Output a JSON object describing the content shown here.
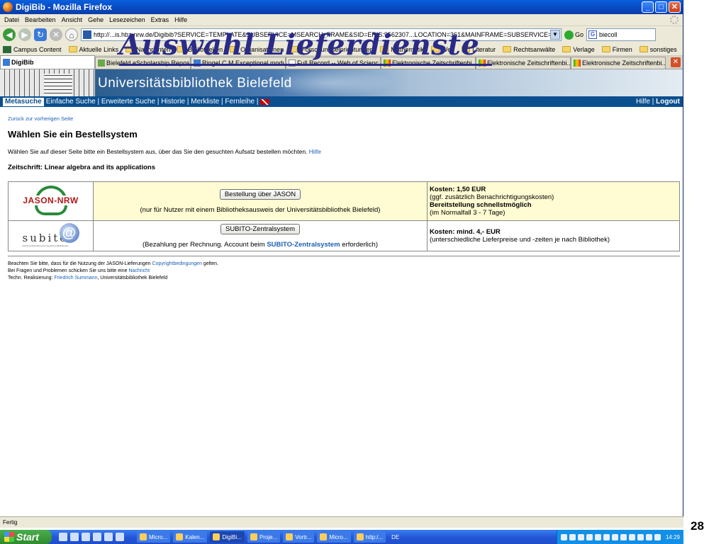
{
  "window": {
    "title": "DigiBib - Mozilla Firefox",
    "minimize": "_",
    "maximize": "□",
    "close": "✕"
  },
  "menu": [
    "Datei",
    "Bearbeiten",
    "Ansicht",
    "Gehe",
    "Lesezeichen",
    "Extras",
    "Hilfe"
  ],
  "navbar": {
    "url": "http://...is.hbz-nrw.de/Digibib?SERVICE=TEMPLATE&SUBSERVICE=MSEARCH_FRAME&SID=ERIS:9562307...LOCATION=361&MAINFRAME=SUBSERVICE=MSEARCH_SEARCH",
    "go_label": "Go",
    "search_value": "biecoll",
    "search_engine_icon": "G"
  },
  "bookmarks": [
    "Campus Content",
    "Aktuelle Links",
    "Nachrichten",
    "Bibliotheken",
    "Organisationen",
    "Forschungseinrichtungen",
    "Mathematik",
    "Web",
    "Literatur",
    "Rechtsanwälte",
    "Verlage",
    "Firmen",
    "sonstiges"
  ],
  "tabs": [
    {
      "label": "DigiBib",
      "active": true
    },
    {
      "label": "Bielefeld eScholarship Reposi...",
      "active": false
    },
    {
      "label": "Ringel C M Exceptional modul...",
      "active": false
    },
    {
      "label": "Full Record -- Web of Scienc...",
      "active": false
    },
    {
      "label": "Elektronische Zeitschriftenbi...",
      "active": false
    },
    {
      "label": "Elektronische Zeitschriftenbi...",
      "active": false
    },
    {
      "label": "Elektronische Zeitschriftenbi...",
      "active": false
    }
  ],
  "tab_close": "✕",
  "banner": {
    "title": "Universitätsbibliothek Bielefeld"
  },
  "bluenav": {
    "active": "Metasuche",
    "links": "Einfache Suche | Erweiterte Suche | Historie | Merkliste | Fernleihe |",
    "help": "Hilfe",
    "separator": "|",
    "logout": "Logout"
  },
  "content": {
    "back_link": "Zurück zur vorherigen Seite",
    "heading": "Wählen Sie ein Bestellsystem",
    "intro": "Wählen Sie auf dieser Seite bitte ein Bestellsystem aus, über das Sie den gesuchten Aufsatz bestellen möchten.",
    "intro_help": "Hilfe",
    "journal": "Zeitschrift: Linear algebra and its applications"
  },
  "order_rows": [
    {
      "logo_text": "JASON-NRW",
      "button": "Bestellung über JASON",
      "note": "(nur für Nutzer mit einem Bibliotheksausweis der Universitätsbibliothek Bielefeld)",
      "cost": "Kosten: 1,50 EUR",
      "cost_note": "(ggf. zusätzlich Benachrichtigungskosten)",
      "delivery": "Bereitstellung schnellstmöglich",
      "delivery_note": "(im Normalfall 3 - 7 Tage)"
    },
    {
      "logo_text": "subito",
      "logo_at": "@",
      "logo_sub": "Dokumentlieferdienst der deutschen Bibliotheken",
      "button": "SUBITO-Zentralsystem",
      "note_before": "(Bezahlung per Rechnung. Account beim",
      "note_link": "SUBITO-Zentralsystem",
      "note_after": "erforderlich)",
      "cost": "Kosten: mind. 4,- EUR",
      "cost_note": "(unterschiedliche Lieferpreise und -zeiten je nach Bibliothek)"
    }
  ],
  "footer": {
    "line1_before": "Beachten Sie bitte, dass für die Nutzung der JASON-Lieferungen",
    "line1_link": "Copyrightbedingungen",
    "line1_after": "gelten.",
    "line2_before": "Bei Fragen und Problemen schicken Sie uns bitte eine",
    "line2_link": "Nachricht",
    "line3_before": "Techn. Realisierung:",
    "line3_link": "Friedrich Summann",
    "line3_after": ", Universitätsbibliothek Bielefeld"
  },
  "statusbar": "Fertig",
  "taskbar": {
    "start": "Start",
    "items": [
      "Micro...",
      "Kalen...",
      "DigiBi...",
      "Proje...",
      "Vortr...",
      "Micro...",
      "http:/..."
    ],
    "active_index": 2,
    "lang": "DE",
    "time": "14:29"
  },
  "overlay": {
    "title": "Auswahl Lieferdienste",
    "slide_number": "28"
  }
}
